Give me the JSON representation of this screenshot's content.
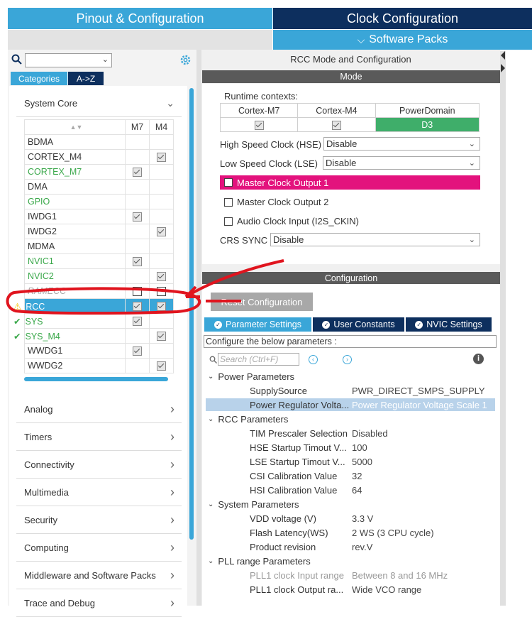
{
  "tabs": {
    "pinout": "Pinout & Configuration",
    "clock": "Clock Configuration",
    "software_packs": "Software Packs"
  },
  "left": {
    "category_tabs": [
      "Categories",
      "A->Z"
    ],
    "system_core": "System Core",
    "columns": {
      "m7": "M7",
      "m4": "M4"
    },
    "peripherals": [
      {
        "name": "BDMA",
        "style": "normal",
        "m7": "",
        "m4": ""
      },
      {
        "name": "CORTEX_M4",
        "style": "normal",
        "m7": "",
        "m4": "on"
      },
      {
        "name": "CORTEX_M7",
        "style": "green",
        "m7": "on",
        "m4": ""
      },
      {
        "name": "DMA",
        "style": "normal",
        "m7": "",
        "m4": ""
      },
      {
        "name": "GPIO",
        "style": "green",
        "m7": "",
        "m4": ""
      },
      {
        "name": "IWDG1",
        "style": "normal",
        "m7": "on",
        "m4": ""
      },
      {
        "name": "IWDG2",
        "style": "normal",
        "m7": "",
        "m4": "on"
      },
      {
        "name": "MDMA",
        "style": "normal",
        "m7": "",
        "m4": ""
      },
      {
        "name": "NVIC1",
        "style": "green",
        "m7": "on",
        "m4": ""
      },
      {
        "name": "NVIC2",
        "style": "green",
        "m7": "",
        "m4": "on"
      },
      {
        "name": "RAMECC",
        "style": "gray",
        "m7": "empty",
        "m4": "empty"
      },
      {
        "name": "RCC",
        "style": "selected",
        "m7": "on",
        "m4": "on",
        "mark": "warn"
      },
      {
        "name": "SYS",
        "style": "green",
        "m7": "on",
        "m4": "",
        "mark": "ok"
      },
      {
        "name": "SYS_M4",
        "style": "green",
        "m7": "",
        "m4": "on",
        "mark": "ok"
      },
      {
        "name": "WWDG1",
        "style": "normal",
        "m7": "on",
        "m4": ""
      },
      {
        "name": "WWDG2",
        "style": "normal",
        "m7": "",
        "m4": "on"
      }
    ],
    "sections": [
      "Analog",
      "Timers",
      "Connectivity",
      "Multimedia",
      "Security",
      "Computing",
      "Middleware and Software Packs",
      "Trace and Debug"
    ]
  },
  "rcc": {
    "title": "RCC Mode and Configuration",
    "mode_bar": "Mode",
    "runtime_contexts": "Runtime contexts:",
    "contexts": [
      "Cortex-M7",
      "Cortex-M4",
      "PowerDomain"
    ],
    "power_domain_value": "D3",
    "hse_label": "High Speed Clock (HSE)",
    "hse_value": "Disable",
    "lse_label": "Low Speed Clock (LSE)",
    "lse_value": "Disable",
    "mco1": "Master Clock Output 1",
    "mco2": "Master Clock Output 2",
    "audio_clock": "Audio Clock Input (I2S_CKIN)",
    "crs_label": "CRS SYNC",
    "crs_value": "Disable",
    "config_bar": "Configuration",
    "reset_button": "Reset Configuration",
    "param_tabs": [
      "Parameter Settings",
      "User Constants",
      "NVIC Settings"
    ],
    "hint": "Configure the below parameters :",
    "search_placeholder": "Search (Ctrl+F)",
    "groups": {
      "power": "Power Parameters",
      "rcc": "RCC Parameters",
      "system": "System Parameters",
      "pll": "PLL range Parameters"
    },
    "params": {
      "supply_source": {
        "name": "SupplySource",
        "value": "PWR_DIRECT_SMPS_SUPPLY"
      },
      "power_reg": {
        "name": "Power Regulator Volta...",
        "value": "Power Regulator Voltage Scale 1"
      },
      "tim_presc": {
        "name": "TIM Prescaler Selection",
        "value": "Disabled"
      },
      "hse_startup": {
        "name": "HSE Startup Timout V...",
        "value": "100"
      },
      "lse_startup": {
        "name": "LSE Startup Timout V...",
        "value": "5000"
      },
      "csi_cal": {
        "name": "CSI Calibration Value",
        "value": "32"
      },
      "hsi_cal": {
        "name": "HSI Calibration Value",
        "value": "64"
      },
      "vdd": {
        "name": "VDD voltage (V)",
        "value": "3.3 V"
      },
      "flash_lat": {
        "name": "Flash Latency(WS)",
        "value": "2 WS (3 CPU cycle)"
      },
      "product_rev": {
        "name": "Product revision",
        "value": "rev.V"
      },
      "pll1_in": {
        "name": "PLL1 clock Input range",
        "value": "Between 8 and 16 MHz"
      },
      "pll1_out": {
        "name": "PLL1 clock Output ra...",
        "value": "Wide VCO range"
      }
    }
  }
}
